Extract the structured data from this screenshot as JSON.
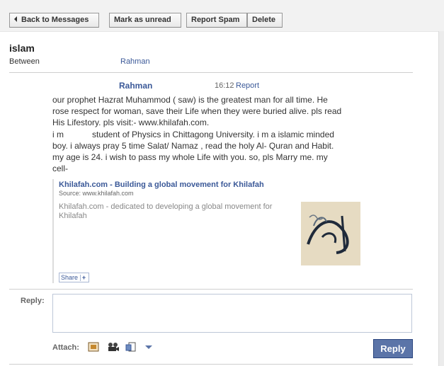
{
  "toolbar": {
    "back_label": "Back to Messages",
    "mark_unread_label": "Mark as unread",
    "report_spam_label": "Report Spam",
    "delete_label": "Delete"
  },
  "thread": {
    "subject": "islam",
    "between_label": "Between",
    "between_name": "Rahman"
  },
  "message": {
    "sender": "Rahman",
    "time": "16:12",
    "report_label": "Report",
    "body_lines": [
      "our prophet Hazrat Muhammod ( saw) is the greatest man for all time. He",
      "rose respect for woman, save their Life when they were buried alive. pls read",
      "His Lifestory. pls visit:- www.khilafah.com.",
      "i m            student of Physics in Chittagong University. i m a islamic minded",
      "boy. i always pray 5 time Salat/ Namaz , read the holy Al- Quran and Habit.",
      "my age is 24. i wish to pass my whole Life with you. so, pls Marry me. my",
      "cell-"
    ]
  },
  "attachment": {
    "title": "Khilafah.com - Building a global movement for Khilafah",
    "source": "Source: www.khilafah.com",
    "description": "Khilafah.com - dedicated to developing a global movement for Khilafah",
    "share_label": "Share",
    "share_plus": "+",
    "image_icon": "calligraphy-image"
  },
  "reply": {
    "label": "Reply:",
    "value": "",
    "attach_label": "Attach:",
    "attach_icons": [
      "photo-icon",
      "video-icon",
      "link-icon",
      "dropdown-arrow-icon"
    ],
    "button_label": "Reply"
  },
  "colors": {
    "link": "#3b5998",
    "reply_button": "#5b74a8"
  }
}
